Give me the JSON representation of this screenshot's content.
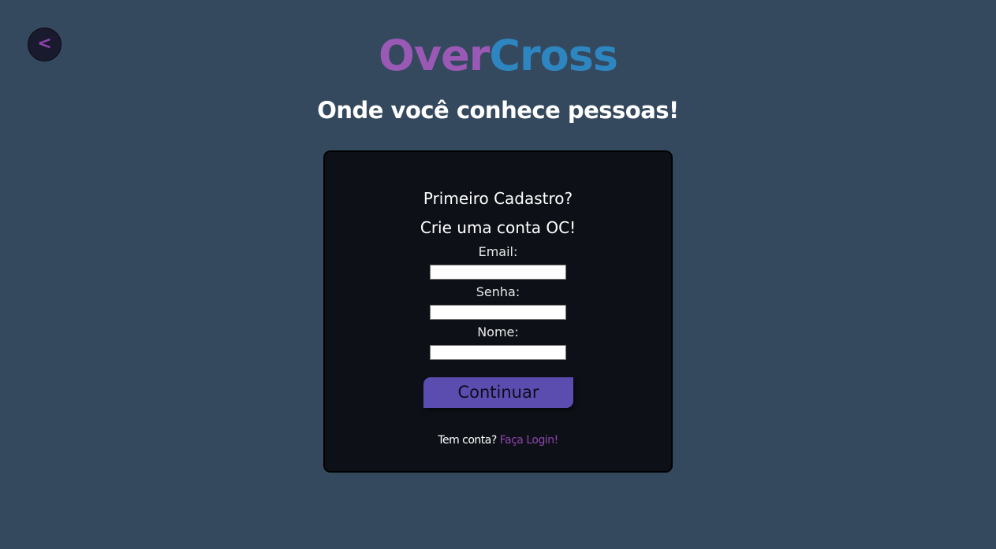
{
  "back_button": {
    "label": "<",
    "icon": "chevron-left-icon"
  },
  "logo": {
    "part1": "Over",
    "part2": "Cross"
  },
  "tagline": "Onde você conhece pessoas!",
  "card": {
    "title_line1": "Primeiro Cadastro?",
    "title_line2": "Crie uma conta OC!",
    "fields": [
      {
        "label": "Email:",
        "value": "",
        "placeholder": ""
      },
      {
        "label": "Senha:",
        "value": "",
        "placeholder": ""
      },
      {
        "label": "Nome:",
        "value": "",
        "placeholder": ""
      }
    ],
    "continue_label": "Continuar",
    "footer_text": "Tem conta?",
    "login_link": "Faça Login!"
  },
  "colors": {
    "background": "#34495e",
    "card_background": "#0d1117",
    "logo_over": "#9b59b6",
    "logo_cross": "#2e86c1",
    "button": "#5b4db0",
    "link": "#8e44ad"
  }
}
